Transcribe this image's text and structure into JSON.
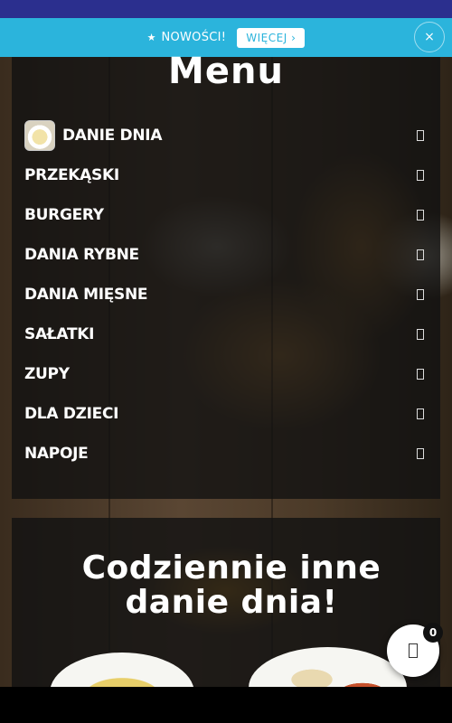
{
  "promo": {
    "label": "NOWOŚCI!",
    "button_label": "WIĘCEJ",
    "close_label": "×"
  },
  "menu": {
    "title": "Menu",
    "items": [
      {
        "label": "DANIE DNIA"
      },
      {
        "label": "PRZEKĄSKI"
      },
      {
        "label": "BURGERY"
      },
      {
        "label": "DANIA RYBNE"
      },
      {
        "label": "DANIA MIĘSNE"
      },
      {
        "label": "SAŁATKI"
      },
      {
        "label": "ZUPY"
      },
      {
        "label": "DLA DZIECI"
      },
      {
        "label": "NAPOJE"
      }
    ]
  },
  "daily": {
    "title_line1": "Codziennie inne",
    "title_line2": "danie dnia!"
  },
  "cart": {
    "count": "0"
  },
  "colors": {
    "promo_bar": "#2bb4dc",
    "status_bar": "#2b2f8e"
  }
}
